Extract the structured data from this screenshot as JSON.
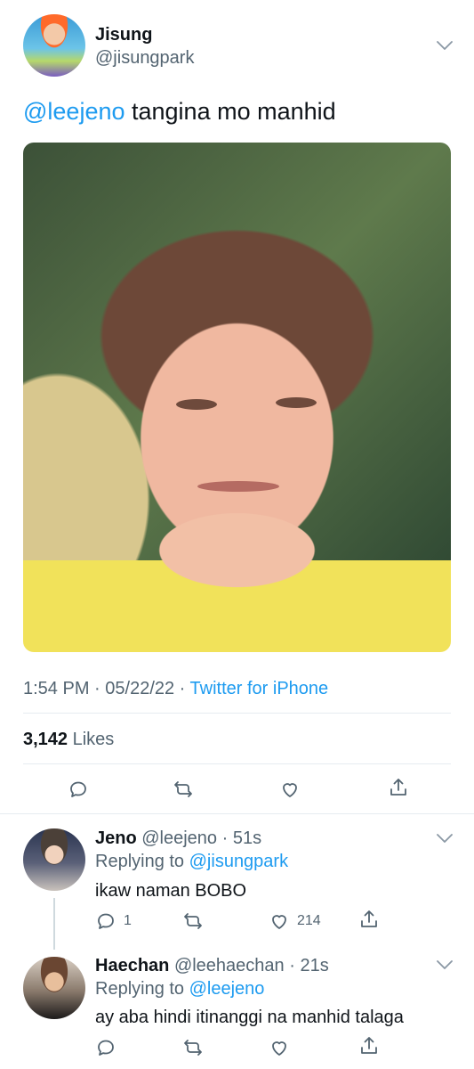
{
  "main_tweet": {
    "name": "Jisung",
    "handle": "@jisungpark",
    "mention": "@leejeno",
    "text": " tangina mo manhid",
    "time": "1:54 PM",
    "date": "05/22/22",
    "source": "Twitter for iPhone",
    "likes_count": "3,142",
    "likes_label": " Likes"
  },
  "replies": [
    {
      "name": "Jeno",
      "handle": "@leejeno",
      "time": "51s",
      "replying_prefix": "Replying to ",
      "replying_to": "@jisungpark",
      "text": "ikaw naman BOBO",
      "reply_count": "1",
      "like_count": "214"
    },
    {
      "name": "Haechan",
      "handle": "@leehaechan",
      "time": "21s",
      "replying_prefix": "Replying to ",
      "replying_to": "@leejeno",
      "text": "ay aba hindi itinanggi na manhid talaga"
    }
  ],
  "icons": [
    "chevron-down-icon",
    "reply-icon",
    "retweet-icon",
    "like-icon",
    "share-icon"
  ],
  "colors": {
    "accent": "#1d9bf0",
    "text": "#0f1419",
    "muted": "#536471",
    "divider": "#e6ecf0"
  }
}
